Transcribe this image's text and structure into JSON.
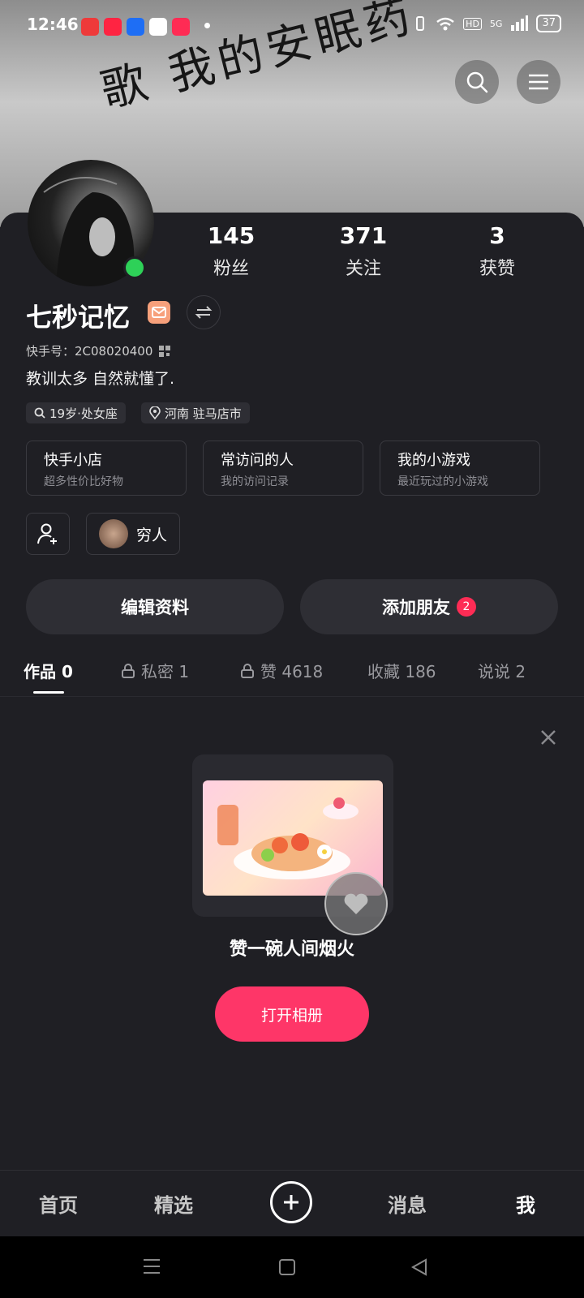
{
  "status_bar": {
    "time": "12:46",
    "right_labels": [
      "HD",
      "5G"
    ],
    "battery": "37"
  },
  "banner": {
    "text": "歌 我的安眠药"
  },
  "profile": {
    "stats": [
      {
        "value": "145",
        "label": "粉丝"
      },
      {
        "value": "371",
        "label": "关注"
      },
      {
        "value": "3",
        "label": "获赞"
      }
    ],
    "name": "七秒记忆",
    "id_text": "快手号：2C08020400",
    "bio": "教训太多 自然就懂了.",
    "chips": [
      {
        "icon": "search-icon",
        "label": "19岁·处女座"
      },
      {
        "icon": "location-icon",
        "label": "河南 驻马店市"
      }
    ]
  },
  "cards": [
    {
      "title": "快手小店",
      "sub": "超多性价比好物"
    },
    {
      "title": "常访问的人",
      "sub": "我的访问记录"
    },
    {
      "title": "我的小游戏",
      "sub": "最近玩过的小游戏"
    }
  ],
  "visitor": {
    "label": "穷人"
  },
  "actions": {
    "edit": "编辑资料",
    "add_friend": "添加朋友",
    "add_friend_badge": "2"
  },
  "tabs": [
    {
      "label": "作品 0",
      "locked": false,
      "active": true
    },
    {
      "label": "私密 1",
      "locked": true,
      "active": false
    },
    {
      "label": "赞 4618",
      "locked": true,
      "active": false
    },
    {
      "label": "收藏 186",
      "locked": false,
      "active": false
    },
    {
      "label": "说说 2",
      "locked": false,
      "active": false
    }
  ],
  "promo": {
    "title": "赞一碗人间烟火",
    "button": "打开相册"
  },
  "nav": {
    "items": [
      "首页",
      "精选",
      "消息",
      "我"
    ]
  }
}
